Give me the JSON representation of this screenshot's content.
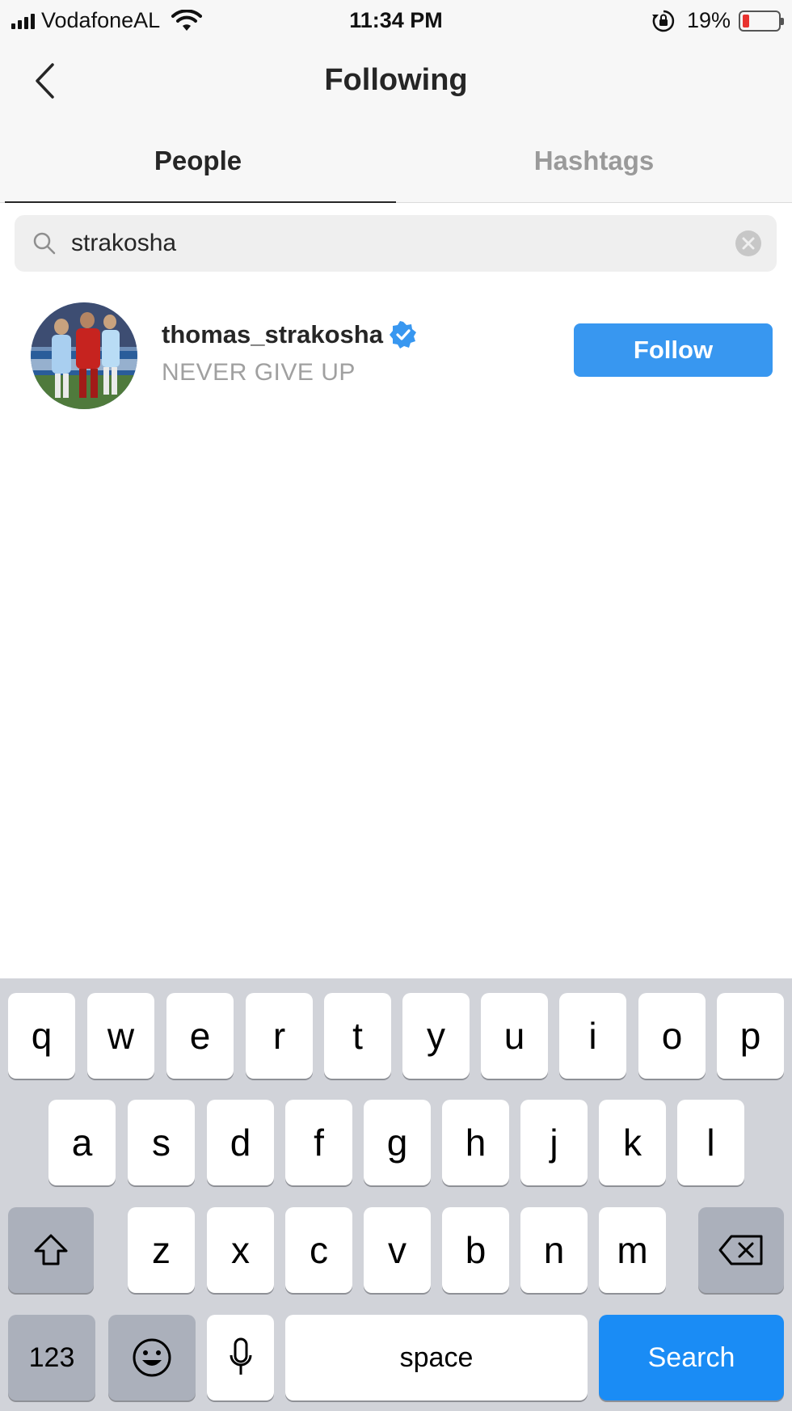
{
  "status_bar": {
    "carrier": "VodafoneAL",
    "time": "11:34 PM",
    "battery_percent": "19%",
    "battery_level": 0.19,
    "battery_color": "#e8322f",
    "icons": [
      "signal-bars-icon",
      "wifi-icon",
      "rotation-lock-icon",
      "battery-icon"
    ]
  },
  "header": {
    "title": "Following",
    "back_icon": "chevron-left-icon"
  },
  "tabs": [
    {
      "label": "People",
      "active": true
    },
    {
      "label": "Hashtags",
      "active": false
    }
  ],
  "search": {
    "value": "strakosha",
    "icon": "search-icon",
    "clear_icon": "clear-icon"
  },
  "results": [
    {
      "username": "thomas_strakosha",
      "verified": true,
      "bio": "NEVER GIVE UP",
      "action_label": "Follow",
      "action_color": "#3897f0"
    }
  ],
  "keyboard": {
    "row1": [
      "q",
      "w",
      "e",
      "r",
      "t",
      "y",
      "u",
      "i",
      "o",
      "p"
    ],
    "row2": [
      "a",
      "s",
      "d",
      "f",
      "g",
      "h",
      "j",
      "k",
      "l"
    ],
    "row3": [
      "z",
      "x",
      "c",
      "v",
      "b",
      "n",
      "m"
    ],
    "numbers_label": "123",
    "space_label": "space",
    "return_label": "Search",
    "return_color": "#1a8cf5",
    "icons": [
      "shift-icon",
      "backspace-icon",
      "emoji-icon",
      "microphone-icon"
    ]
  }
}
